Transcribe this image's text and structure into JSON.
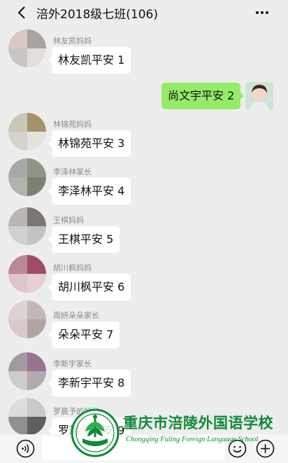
{
  "header": {
    "title": "涪外2018级七班(106)",
    "back_icon": "chevron-left-icon",
    "more_icon": "more-dots-icon"
  },
  "messages": [
    {
      "sender": "林友凯妈妈",
      "text": "林友凯平安 1"
    },
    {
      "sender": "self",
      "text": "尚文宇平安 2"
    },
    {
      "sender": "林锦苑妈妈",
      "text": "林锦苑平安 3"
    },
    {
      "sender": "李泽林家长",
      "text": "李泽林平安 4"
    },
    {
      "sender": "王棋妈妈",
      "text": "王棋平安 5"
    },
    {
      "sender": "胡川枫妈妈",
      "text": "胡川枫平安 6"
    },
    {
      "sender": "周妍朵朵家长",
      "text": "朵朵平安 7"
    },
    {
      "sender": "李新宇家长",
      "text": "李新宇平安 8"
    },
    {
      "sender": "罗晨予的妈妈",
      "text": "罗晨予平安 9"
    }
  ],
  "input": {
    "voice_icon": "voice-icon",
    "emoji_icon": "emoji-icon",
    "plus_icon": "plus-icon"
  },
  "watermark": {
    "school_name": "重庆市涪陵外国语学校",
    "school_name_en": "Chongqing Fuling Foreign Language School"
  },
  "colors": {
    "self_bubble": "#95ec69",
    "brand_green": "#0f8a3a",
    "background": "#ededed"
  }
}
